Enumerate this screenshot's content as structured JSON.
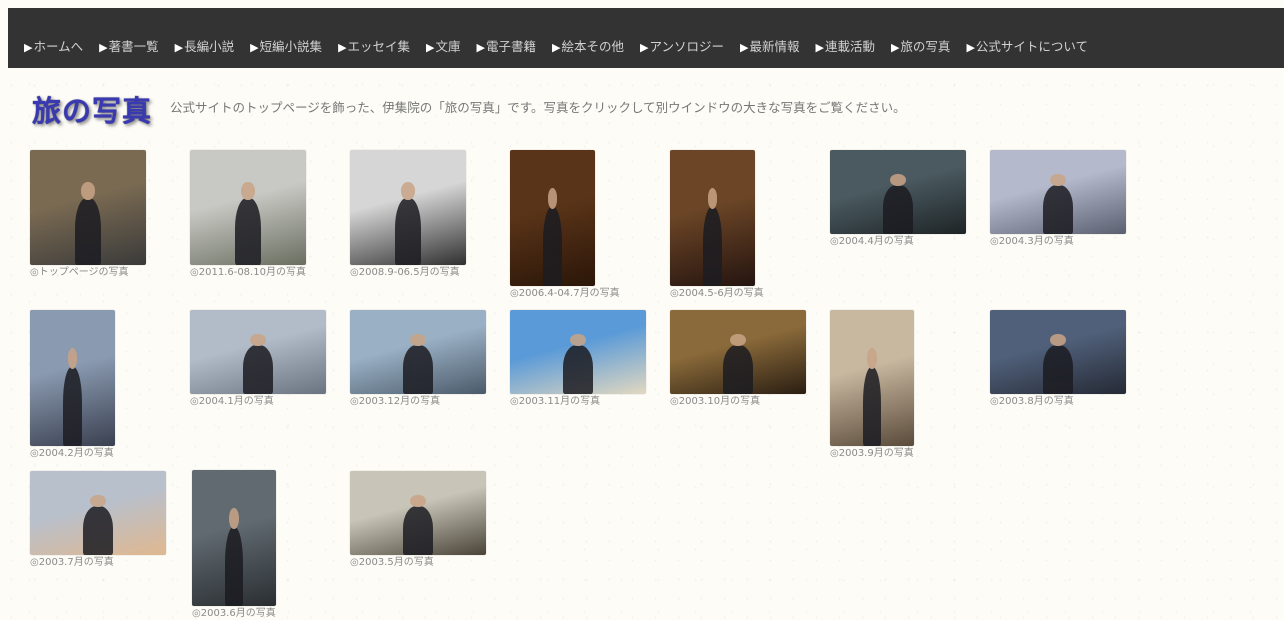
{
  "nav": {
    "marker": "▶",
    "items": [
      "ホームへ",
      "著書一覧",
      "長編小説",
      "短編小説集",
      "エッセイ集",
      "文庫",
      "電子書籍",
      "絵本その他",
      "アンソロジー",
      "最新情報",
      "連載活動",
      "旅の写真",
      "公式サイトについて"
    ]
  },
  "header": {
    "title": "旅の写真",
    "intro": "公式サイトのトップページを飾った、伊集院の「旅の写真」です。写真をクリックして別ウインドウの大きな写真をご覧ください。"
  },
  "photos": [
    {
      "caption": "◎トップページの写真",
      "colors": [
        "#7a6a52",
        "#3a3a3a"
      ]
    },
    {
      "caption": "◎2011.6-08.10月の写真",
      "colors": [
        "#c8c9c4",
        "#6a6e60"
      ]
    },
    {
      "caption": "◎2008.9-06.5月の写真",
      "colors": [
        "#d6d6d6",
        "#303030"
      ]
    },
    {
      "caption": "◎2006.4-04.7月の写真",
      "colors": [
        "#5a3418",
        "#2a1608"
      ]
    },
    {
      "caption": "◎2004.5-6月の写真",
      "colors": [
        "#6b4526",
        "#241410"
      ]
    },
    {
      "caption": "◎2004.4月の写真",
      "colors": [
        "#4a5a60",
        "#1e2426"
      ]
    },
    {
      "caption": "◎2004.3月の写真",
      "colors": [
        "#b4bacc",
        "#5a6070"
      ]
    },
    {
      "caption": "◎2004.2月の写真",
      "colors": [
        "#8a9ab0",
        "#3a4050"
      ]
    },
    {
      "caption": "◎2004.1月の写真",
      "colors": [
        "#b2bcc8",
        "#6a7480"
      ]
    },
    {
      "caption": "◎2003.12月の写真",
      "colors": [
        "#9ab0c4",
        "#4a5a6a"
      ]
    },
    {
      "caption": "◎2003.11月の写真",
      "colors": [
        "#5a9ad8",
        "#e2d8c0"
      ]
    },
    {
      "caption": "◎2003.10月の写真",
      "colors": [
        "#8a6a3a",
        "#2a1e12"
      ]
    },
    {
      "caption": "◎2003.9月の写真",
      "colors": [
        "#c8b8a0",
        "#5a4a3a"
      ]
    },
    {
      "caption": "◎2003.8月の写真",
      "colors": [
        "#50607a",
        "#252a35"
      ]
    },
    {
      "caption": "◎2003.7月の写真",
      "colors": [
        "#b8c0cc",
        "#e0b890"
      ]
    },
    {
      "caption": "◎2003.6月の写真",
      "colors": [
        "#606a70",
        "#2a2e32"
      ]
    },
    {
      "caption": "◎2003.5月の写真",
      "colors": [
        "#c8c4b8",
        "#4a4438"
      ]
    }
  ]
}
